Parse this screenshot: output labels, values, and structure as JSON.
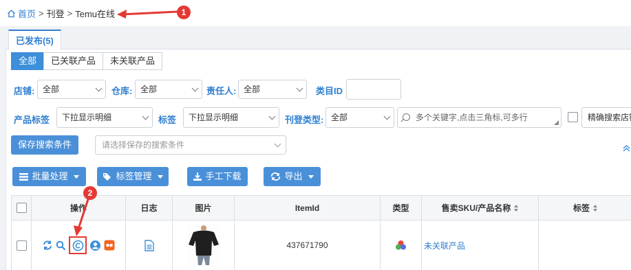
{
  "breadcrumb": {
    "home": "首页",
    "sep1": ">",
    "level2": "刊登",
    "sep2": ">",
    "current": "Temu在线"
  },
  "tab": {
    "label": "已发布(5)"
  },
  "segments": [
    "全部",
    "已关联产品",
    "未关联产品"
  ],
  "filters": {
    "store_label": "店铺:",
    "store_value": "全部",
    "warehouse_label": "仓库:",
    "warehouse_value": "全部",
    "owner_label": "责任人:",
    "owner_value": "全部",
    "category_label": "类目ID",
    "product_tag_label": "产品标签",
    "product_tag_value": "下拉显示明细",
    "tag_label": "标签",
    "tag_value": "下拉显示明细",
    "listing_type_label": "刊登类型:",
    "listing_type_value": "全部",
    "search_placeholder": "多个关键字,点击三角标,可多行",
    "exact_search_label": "精确搜索店铺"
  },
  "save_search": {
    "button": "保存搜索条件",
    "placeholder": "请选择保存的搜索条件"
  },
  "toolbar": {
    "batch": "批量处理",
    "tag_manage": "标签管理",
    "manual_download": "手工下载",
    "export": "导出"
  },
  "table": {
    "headers": {
      "action": "操作",
      "log": "日志",
      "image": "图片",
      "item_id": "ItemId",
      "type": "类型",
      "sku": "售卖SKU/产品名称",
      "tags": "标签"
    },
    "rows": [
      {
        "item_id": "437671790",
        "sku": "未关联产品"
      }
    ]
  },
  "annotations": {
    "badge1": "1",
    "badge2": "2"
  },
  "colors": {
    "primary": "#4a90d9",
    "link": "#2f7fd1",
    "annotation": "#e53935",
    "orange": "#f26522"
  }
}
